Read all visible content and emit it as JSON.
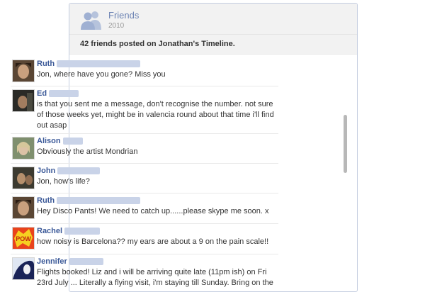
{
  "header": {
    "title": "Friends",
    "year": "2010",
    "summary": "42 friends posted on Jonathan's Timeline."
  },
  "posts": [
    {
      "name": "Ruth",
      "message": "Jon, where have you gone? Miss you"
    },
    {
      "name": "Ed",
      "message": "is that you sent me a message, don't recognise the number. not sure of those weeks yet, might be in valencia round about that time i'll find out asap"
    },
    {
      "name": "Alison",
      "message": "Obviously the artist Mondrian"
    },
    {
      "name": "John",
      "message": "Jon, how's life?"
    },
    {
      "name": "Ruth",
      "message": "Hey Disco Pants! We need to catch up......please skype me soon. x"
    },
    {
      "name": "Rachel",
      "message": "how noisy is Barcelona?? my ears are about a 9 on the pain scale!!"
    },
    {
      "name": "Jennifer",
      "message": "Flights booked! Liz and i will be arriving quite late (11pm ish) on Fri 23rd July ... Literally a flying visit, i'm staying till Sunday. Bring on the"
    }
  ],
  "avatars": {
    "rachel_badge": "POW"
  },
  "colors": {
    "link": "#3b5998",
    "header_bg": "#f2f2f2",
    "border": "#c4cde0",
    "title": "#6d84b4"
  }
}
